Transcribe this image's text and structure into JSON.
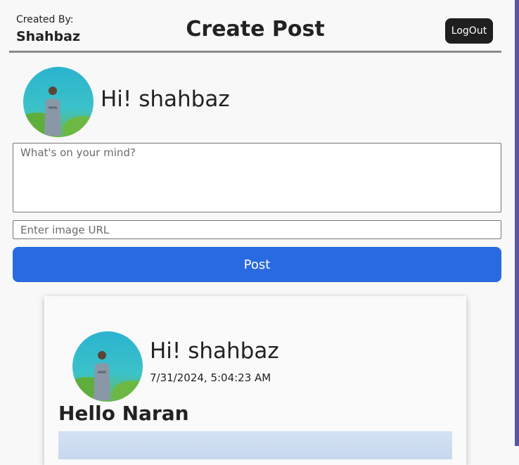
{
  "header": {
    "created_by_label": "Created By:",
    "created_by_name": "Shahbaz",
    "title": "Create Post",
    "logout_label": "LogOut"
  },
  "composer": {
    "greeting": "Hi! shahbaz",
    "text_placeholder": "What's on your mind?",
    "image_placeholder": "Enter image URL",
    "post_label": "Post"
  },
  "feed": {
    "posts": [
      {
        "greeting": "Hi! shahbaz",
        "timestamp": "7/31/2024, 5:04:23 AM",
        "text": "Hello Naran"
      }
    ]
  },
  "colors": {
    "post_button": "#2a6ae0",
    "logout_button": "#1f1f1f",
    "accent_bar": "#5b55a6"
  },
  "icons": {
    "avatar": "user-photo-avatar"
  }
}
